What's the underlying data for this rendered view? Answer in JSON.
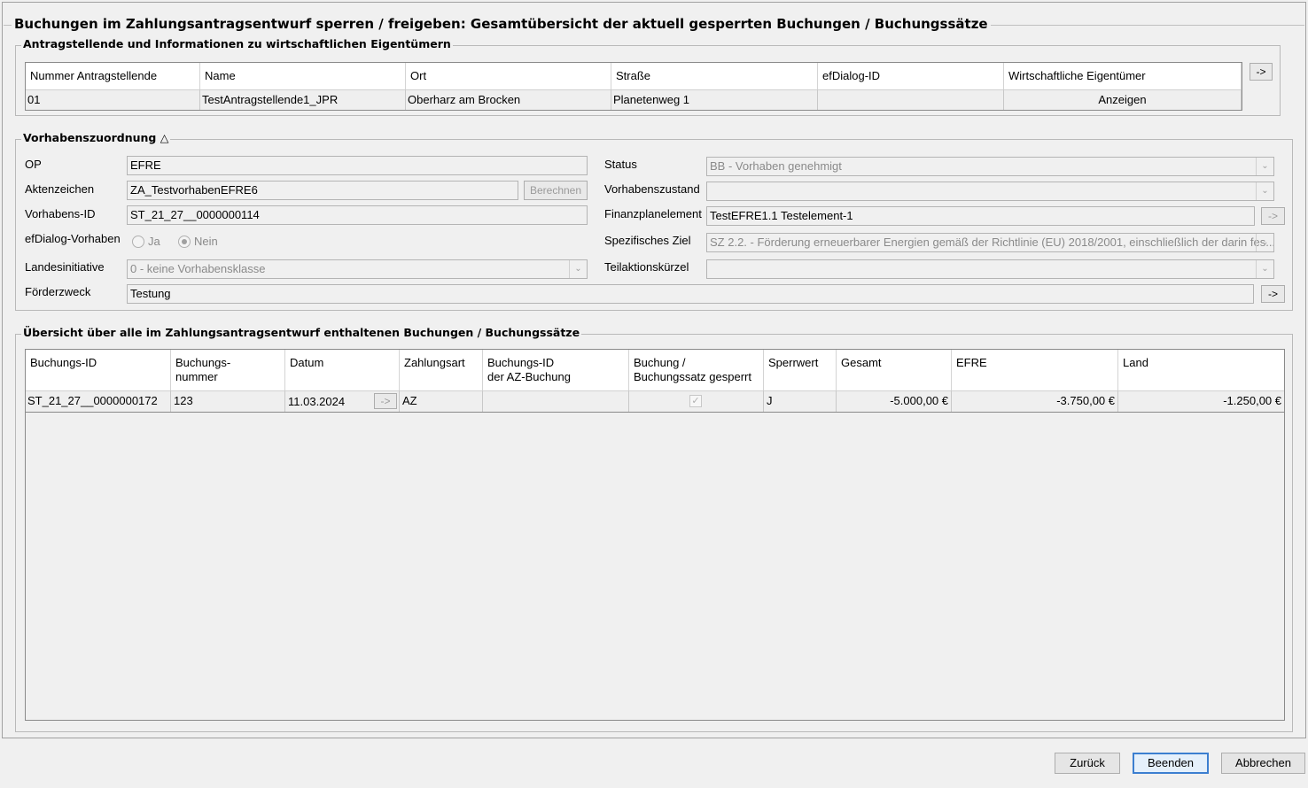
{
  "window": {
    "title": "Buchungen im Zahlungsantragsentwurf sperren / freigeben: Gesamtübersicht der aktuell gesperrten Buchungen / Buchungssätze"
  },
  "applicants": {
    "title": "Antragstellende und Informationen zu wirtschaftlichen Eigentümern",
    "columns": [
      "Nummer Antragstellende",
      "Name",
      "Ort",
      "Straße",
      "efDialog-ID",
      "Wirtschaftliche Eigentümer"
    ],
    "rows": [
      {
        "nummer": "01",
        "name": "TestAntragstellende1_JPR",
        "ort": "Oberharz am Brocken",
        "strasse": "Planetenweg 1",
        "efdialog_id": "",
        "eigentuemer": "Anzeigen"
      }
    ],
    "arrow_button": "->"
  },
  "project": {
    "title": "Vorhabenszuordnung",
    "collapse_icon": "triangle-up-icon",
    "op_label": "OP",
    "op_value": "EFRE",
    "aktenzeichen_label": "Aktenzeichen",
    "aktenzeichen_value": "ZA_TestvorhabenEFRE6",
    "berechnen_label": "Berechnen",
    "vorhabens_id_label": "Vorhabens-ID",
    "vorhabens_id_value": "ST_21_27__0000000114",
    "efdialog_label": "efDialog-Vorhaben",
    "radio_ja": "Ja",
    "radio_nein": "Nein",
    "radio_selected": "Nein",
    "landesinitiative_label": "Landesinitiative",
    "landesinitiative_value": "0 - keine Vorhabensklasse",
    "foerderzweck_label": "Förderzweck",
    "foerderzweck_value": "Testung",
    "status_label": "Status",
    "status_value": "BB - Vorhaben genehmigt",
    "vorhabenszustand_label": "Vorhabenszustand",
    "vorhabenszustand_value": "",
    "finanzplanelement_label": "Finanzplanelement",
    "finanzplanelement_value": "TestEFRE1.1 Testelement-1",
    "spezifisches_ziel_label": "Spezifisches Ziel",
    "spezifisches_ziel_value": "SZ 2.2. - Förderung erneuerbarer Energien gemäß der Richtlinie (EU) 2018/2001, einschließlich der darin fes...",
    "teilaktion_label": "Teilaktionskürzel",
    "teilaktion_value": "",
    "arrow_button": "->"
  },
  "bookings": {
    "title": "Übersicht über alle im Zahlungsantragsentwurf enthaltenen Buchungen / Buchungssätze",
    "columns": [
      {
        "line1": "Buchungs-ID",
        "line2": ""
      },
      {
        "line1": "Buchungs-",
        "line2": "nummer"
      },
      {
        "line1": "Datum",
        "line2": ""
      },
      {
        "line1": "Zahlungsart",
        "line2": ""
      },
      {
        "line1": "Buchungs-ID",
        "line2": "der AZ-Buchung"
      },
      {
        "line1": "Buchung /",
        "line2": "Buchungssatz gesperrt"
      },
      {
        "line1": "Sperrwert",
        "line2": ""
      },
      {
        "line1": "Gesamt",
        "line2": ""
      },
      {
        "line1": "EFRE",
        "line2": ""
      },
      {
        "line1": "Land",
        "line2": ""
      }
    ],
    "rows": [
      {
        "buchungs_id": "ST_21_27__0000000172",
        "nummer": "123",
        "datum": "11.03.2024",
        "datum_button": "->",
        "zahlungsart": "AZ",
        "az_buchung": "",
        "gesperrt": true,
        "sperrwert": "J",
        "gesamt": "-5.000,00 €",
        "efre": "-3.750,00 €",
        "land": "-1.250,00 €"
      }
    ]
  },
  "footer": {
    "zurueck": "Zurück",
    "beenden": "Beenden",
    "abbrechen": "Abbrechen"
  }
}
